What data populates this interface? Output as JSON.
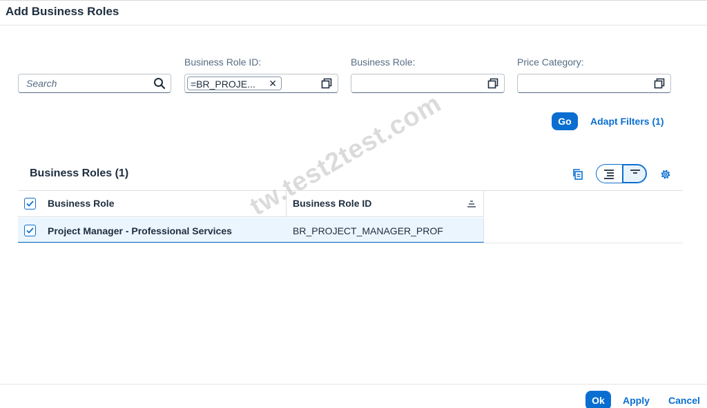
{
  "dialog": {
    "title": "Add Business Roles"
  },
  "filters": {
    "search_placeholder": "Search",
    "business_role_id": {
      "label": "Business Role ID:",
      "token": "=BR_PROJE..."
    },
    "business_role": {
      "label": "Business Role:",
      "value": ""
    },
    "price_category": {
      "label": "Price Category:",
      "value": ""
    },
    "go_label": "Go",
    "adapt_filters_label": "Adapt Filters (1)"
  },
  "table": {
    "title": "Business Roles (1)",
    "columns": [
      "Business Role",
      "Business Role ID"
    ],
    "rows": [
      {
        "business_role": "Project Manager - Professional Services",
        "business_role_id": "BR_PROJECT_MANAGER_PROF",
        "selected": true
      }
    ]
  },
  "watermark": "tw.test2test.com",
  "footer": {
    "ok_label": "Ok",
    "apply_label": "Apply",
    "cancel_label": "Cancel"
  },
  "colors": {
    "accent": "#0a6ed1",
    "text": "#1d2d3e",
    "label": "#556b82",
    "row_selected": "#ebf5fe"
  },
  "icons": [
    "search-icon",
    "value-help-icon",
    "token-remove-icon",
    "copy-icon",
    "expand-icon",
    "collapse-icon",
    "settings-icon",
    "checkbox-check-icon",
    "sort-icon"
  ]
}
